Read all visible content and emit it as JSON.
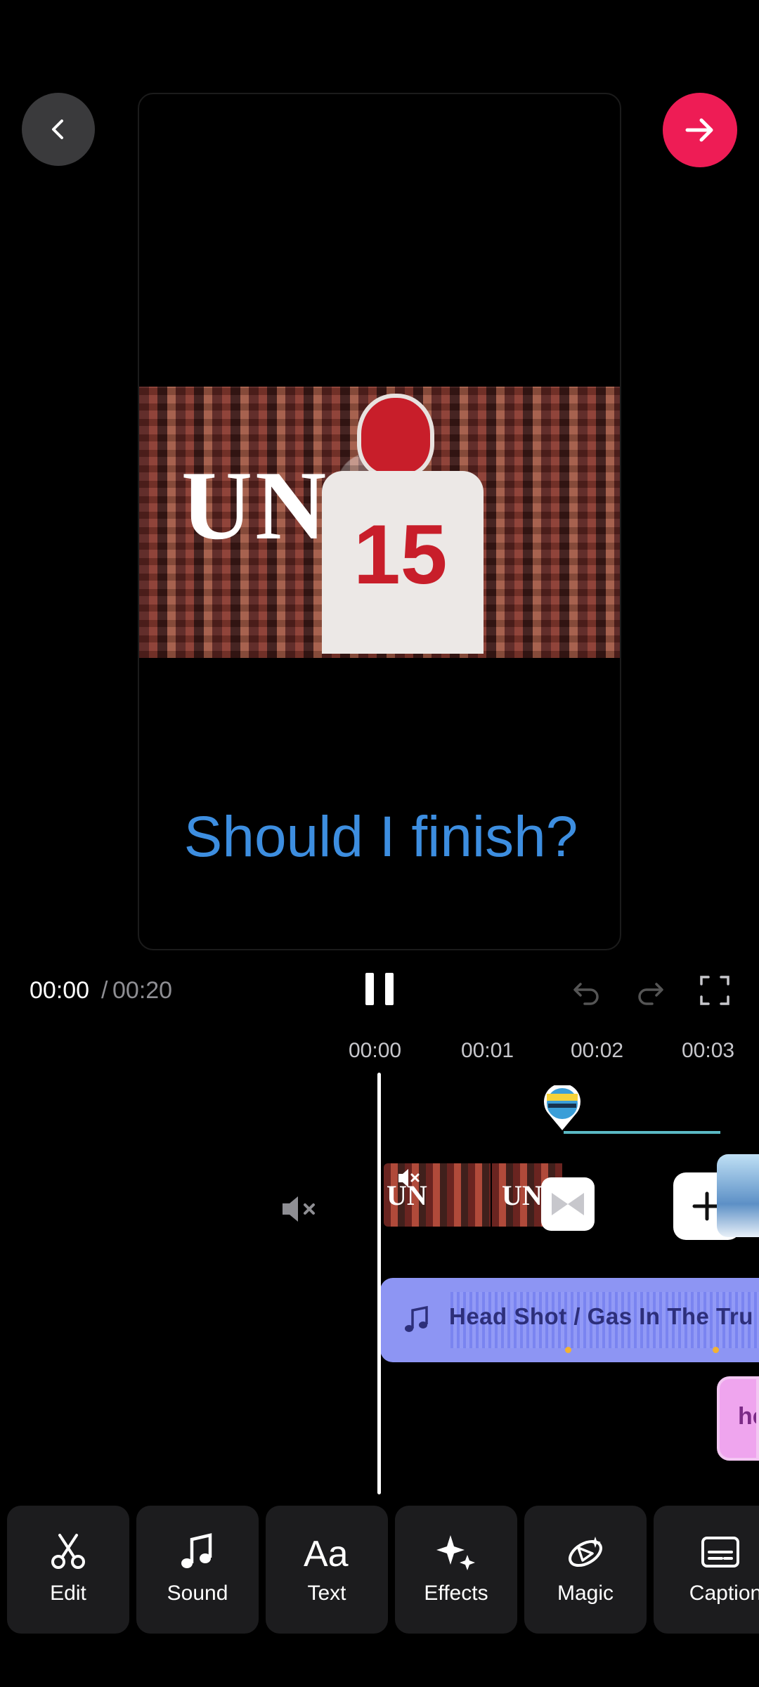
{
  "preview": {
    "overlay_word": "UNI  E",
    "question": "Should I finish?",
    "jersey_number": "15"
  },
  "playback": {
    "current_time": "00:00",
    "separator": "/",
    "total_time": "00:20"
  },
  "timeline": {
    "ticks": [
      "00:00",
      "00:01",
      "00:02",
      "00:03"
    ],
    "clip1_word": "UN",
    "clip2_word": "UNI"
  },
  "sound_track": {
    "title": "Head Shot / Gas In The Tru"
  },
  "text_track": {
    "label": "he"
  },
  "toolbar": {
    "items": [
      {
        "label": "Edit",
        "icon": "scissors-icon"
      },
      {
        "label": "Sound",
        "icon": "music-note-icon"
      },
      {
        "label": "Text",
        "icon": "text-aa-icon"
      },
      {
        "label": "Effects",
        "icon": "sparkles-icon"
      },
      {
        "label": "Magic",
        "icon": "magic-icon"
      },
      {
        "label": "Captions",
        "icon": "captions-icon"
      }
    ]
  },
  "colors": {
    "accent_next": "#ee1c55",
    "question_text": "#3d8ee0",
    "sound_track": "#8d95f3",
    "text_track": "#efa5ee",
    "sticker_line": "#5ab9c4"
  }
}
